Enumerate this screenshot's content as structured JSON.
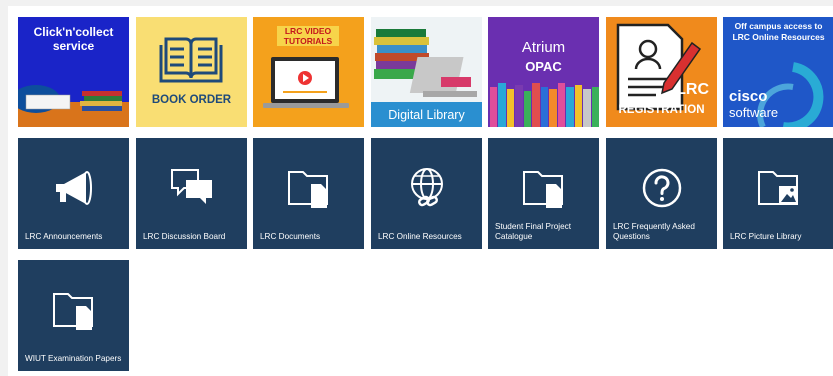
{
  "image_tiles": [
    {
      "text": "Click'n'collect service",
      "icon": "click-collect-illustration"
    },
    {
      "text": "BOOK ORDER",
      "icon": "open-book-icon"
    },
    {
      "text": "LRC VIDEO TUTORIALS",
      "icon": "laptop-play-icon"
    },
    {
      "text": "Digital Library",
      "icon": "books-laptop-illustration"
    },
    {
      "text": "Atrium",
      "subtext": "OPAC",
      "icon": "bookshelf-illustration"
    },
    {
      "text": "LRC",
      "subtext": "REGISTRATION",
      "icon": "form-pencil-icon"
    },
    {
      "text": "Off campus access to LRC Online Resources",
      "subtext": "cisco",
      "subtext2": "software",
      "icon": "cisco-logo"
    }
  ],
  "nav_tiles": [
    {
      "label": "LRC Announcements",
      "icon": "megaphone-icon"
    },
    {
      "label": "LRC Discussion Board",
      "icon": "chat-bubbles-icon"
    },
    {
      "label": "LRC Documents",
      "icon": "folder-document-icon"
    },
    {
      "label": "LRC Online Resources",
      "icon": "globe-link-icon"
    },
    {
      "label": "Student Final Project Catalogue",
      "icon": "folder-document-icon"
    },
    {
      "label": "LRC Frequently Asked Questions",
      "icon": "question-circle-icon"
    },
    {
      "label": "LRC Picture Library",
      "icon": "folder-picture-icon"
    },
    {
      "label": "WIUT Examination Papers",
      "icon": "folder-document-icon"
    }
  ],
  "colors": {
    "nav_tile_bg": "#1f3e5f",
    "page_bg": "#ffffff"
  }
}
